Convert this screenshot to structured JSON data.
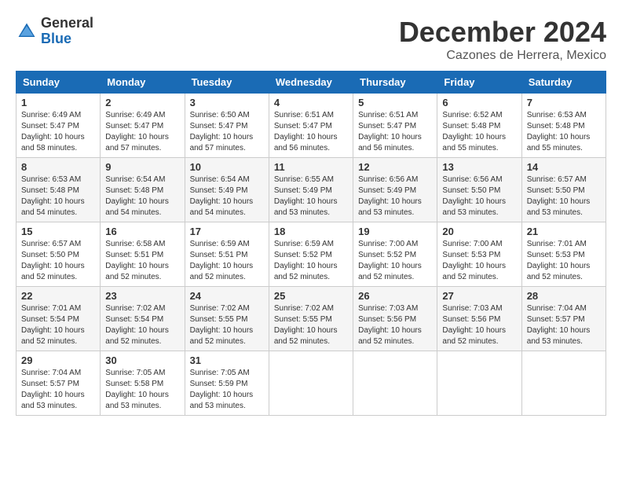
{
  "header": {
    "logo_general": "General",
    "logo_blue": "Blue",
    "month_title": "December 2024",
    "location": "Cazones de Herrera, Mexico"
  },
  "weekdays": [
    "Sunday",
    "Monday",
    "Tuesday",
    "Wednesday",
    "Thursday",
    "Friday",
    "Saturday"
  ],
  "weeks": [
    [
      {
        "day": "1",
        "sunrise": "6:49 AM",
        "sunset": "5:47 PM",
        "daylight": "10 hours and 58 minutes."
      },
      {
        "day": "2",
        "sunrise": "6:49 AM",
        "sunset": "5:47 PM",
        "daylight": "10 hours and 57 minutes."
      },
      {
        "day": "3",
        "sunrise": "6:50 AM",
        "sunset": "5:47 PM",
        "daylight": "10 hours and 57 minutes."
      },
      {
        "day": "4",
        "sunrise": "6:51 AM",
        "sunset": "5:47 PM",
        "daylight": "10 hours and 56 minutes."
      },
      {
        "day": "5",
        "sunrise": "6:51 AM",
        "sunset": "5:47 PM",
        "daylight": "10 hours and 56 minutes."
      },
      {
        "day": "6",
        "sunrise": "6:52 AM",
        "sunset": "5:48 PM",
        "daylight": "10 hours and 55 minutes."
      },
      {
        "day": "7",
        "sunrise": "6:53 AM",
        "sunset": "5:48 PM",
        "daylight": "10 hours and 55 minutes."
      }
    ],
    [
      {
        "day": "8",
        "sunrise": "6:53 AM",
        "sunset": "5:48 PM",
        "daylight": "10 hours and 54 minutes."
      },
      {
        "day": "9",
        "sunrise": "6:54 AM",
        "sunset": "5:48 PM",
        "daylight": "10 hours and 54 minutes."
      },
      {
        "day": "10",
        "sunrise": "6:54 AM",
        "sunset": "5:49 PM",
        "daylight": "10 hours and 54 minutes."
      },
      {
        "day": "11",
        "sunrise": "6:55 AM",
        "sunset": "5:49 PM",
        "daylight": "10 hours and 53 minutes."
      },
      {
        "day": "12",
        "sunrise": "6:56 AM",
        "sunset": "5:49 PM",
        "daylight": "10 hours and 53 minutes."
      },
      {
        "day": "13",
        "sunrise": "6:56 AM",
        "sunset": "5:50 PM",
        "daylight": "10 hours and 53 minutes."
      },
      {
        "day": "14",
        "sunrise": "6:57 AM",
        "sunset": "5:50 PM",
        "daylight": "10 hours and 53 minutes."
      }
    ],
    [
      {
        "day": "15",
        "sunrise": "6:57 AM",
        "sunset": "5:50 PM",
        "daylight": "10 hours and 52 minutes."
      },
      {
        "day": "16",
        "sunrise": "6:58 AM",
        "sunset": "5:51 PM",
        "daylight": "10 hours and 52 minutes."
      },
      {
        "day": "17",
        "sunrise": "6:59 AM",
        "sunset": "5:51 PM",
        "daylight": "10 hours and 52 minutes."
      },
      {
        "day": "18",
        "sunrise": "6:59 AM",
        "sunset": "5:52 PM",
        "daylight": "10 hours and 52 minutes."
      },
      {
        "day": "19",
        "sunrise": "7:00 AM",
        "sunset": "5:52 PM",
        "daylight": "10 hours and 52 minutes."
      },
      {
        "day": "20",
        "sunrise": "7:00 AM",
        "sunset": "5:53 PM",
        "daylight": "10 hours and 52 minutes."
      },
      {
        "day": "21",
        "sunrise": "7:01 AM",
        "sunset": "5:53 PM",
        "daylight": "10 hours and 52 minutes."
      }
    ],
    [
      {
        "day": "22",
        "sunrise": "7:01 AM",
        "sunset": "5:54 PM",
        "daylight": "10 hours and 52 minutes."
      },
      {
        "day": "23",
        "sunrise": "7:02 AM",
        "sunset": "5:54 PM",
        "daylight": "10 hours and 52 minutes."
      },
      {
        "day": "24",
        "sunrise": "7:02 AM",
        "sunset": "5:55 PM",
        "daylight": "10 hours and 52 minutes."
      },
      {
        "day": "25",
        "sunrise": "7:02 AM",
        "sunset": "5:55 PM",
        "daylight": "10 hours and 52 minutes."
      },
      {
        "day": "26",
        "sunrise": "7:03 AM",
        "sunset": "5:56 PM",
        "daylight": "10 hours and 52 minutes."
      },
      {
        "day": "27",
        "sunrise": "7:03 AM",
        "sunset": "5:56 PM",
        "daylight": "10 hours and 52 minutes."
      },
      {
        "day": "28",
        "sunrise": "7:04 AM",
        "sunset": "5:57 PM",
        "daylight": "10 hours and 53 minutes."
      }
    ],
    [
      {
        "day": "29",
        "sunrise": "7:04 AM",
        "sunset": "5:57 PM",
        "daylight": "10 hours and 53 minutes."
      },
      {
        "day": "30",
        "sunrise": "7:05 AM",
        "sunset": "5:58 PM",
        "daylight": "10 hours and 53 minutes."
      },
      {
        "day": "31",
        "sunrise": "7:05 AM",
        "sunset": "5:59 PM",
        "daylight": "10 hours and 53 minutes."
      },
      null,
      null,
      null,
      null
    ]
  ]
}
